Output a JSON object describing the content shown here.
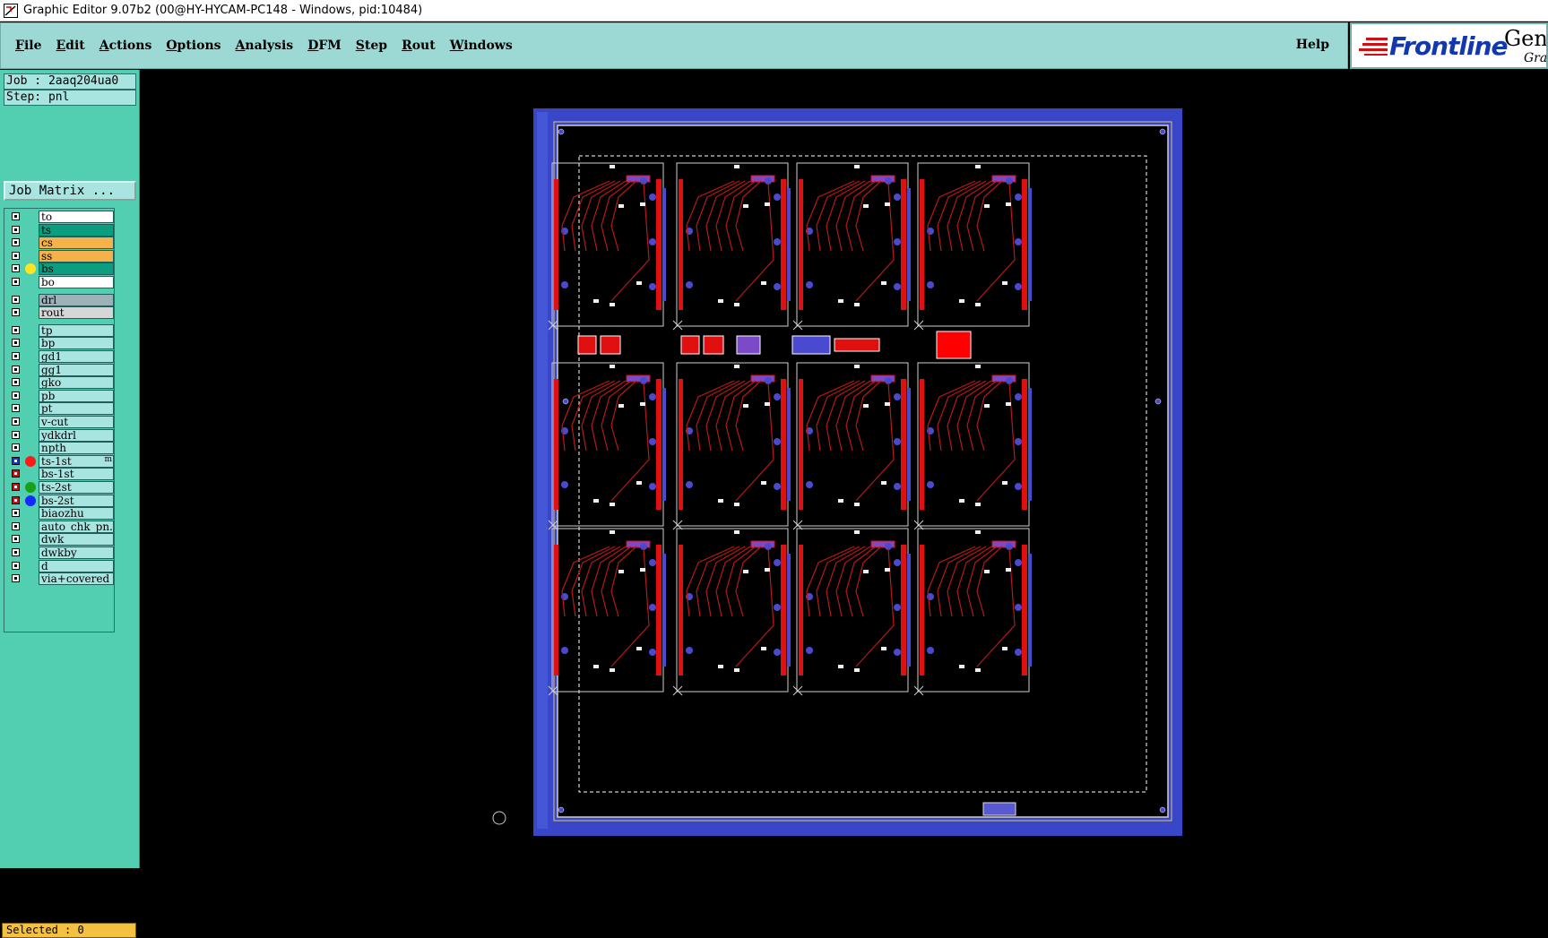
{
  "window": {
    "title": "Graphic Editor 9.07b2 (00@HY-HYCAM-PC148 - Windows, pid:10484)"
  },
  "menubar": {
    "items": [
      {
        "label": "File",
        "ul": "F",
        "rest": "ile"
      },
      {
        "label": "Edit",
        "ul": "E",
        "rest": "dit"
      },
      {
        "label": "Actions",
        "ul": "A",
        "rest": "ctions"
      },
      {
        "label": "Options",
        "ul": "O",
        "rest": "ptions"
      },
      {
        "label": "Analysis",
        "ul": "A",
        "rest": "nalysis"
      },
      {
        "label": "DFM",
        "ul": "D",
        "rest": "FM"
      },
      {
        "label": "Step",
        "ul": "S",
        "rest": "tep"
      },
      {
        "label": "Rout",
        "ul": "R",
        "rest": "out"
      },
      {
        "label": "Windows",
        "ul": "W",
        "rest": "indows"
      }
    ],
    "help": "Help"
  },
  "logo": {
    "brand": "Frontline",
    "product": "Gene",
    "sub": "Grap"
  },
  "job": {
    "job_label": "Job : 2aaq204ua0",
    "step_label": "Step: pnl",
    "matrix_button": "Job Matrix ..."
  },
  "layers": [
    {
      "name": "to",
      "color": "#ffffff"
    },
    {
      "name": "ts",
      "color": "#0a9e7e"
    },
    {
      "name": "cs",
      "color": "#f6b24a"
    },
    {
      "name": "ss",
      "color": "#f6b24a"
    },
    {
      "name": "bs",
      "color": "#0a9e7e",
      "dot": "#ffe51f"
    },
    {
      "name": "bo",
      "color": "#ffffff"
    },
    {
      "name": "drl",
      "color": "#9db2b8",
      "gap": true
    },
    {
      "name": "rout",
      "color": "#d6d6d6"
    },
    {
      "name": "tp",
      "color": "#a8e4e0",
      "gap": true
    },
    {
      "name": "bp",
      "color": "#a8e4e0"
    },
    {
      "name": "gd1",
      "color": "#a8e4e0"
    },
    {
      "name": "gg1",
      "color": "#a8e4e0"
    },
    {
      "name": "gko",
      "color": "#a8e4e0"
    },
    {
      "name": "pb",
      "color": "#a8e4e0"
    },
    {
      "name": "pt",
      "color": "#a8e4e0"
    },
    {
      "name": "v-cut",
      "color": "#a8e4e0"
    },
    {
      "name": "ydkdrl",
      "color": "#a8e4e0"
    },
    {
      "name": "npth",
      "color": "#a8e4e0"
    },
    {
      "name": "ts-1st",
      "color": "#a8e4e0",
      "dot": "#ff1a1a",
      "box": "#1038c8",
      "mark": "m"
    },
    {
      "name": "bs-1st",
      "color": "#a8e4e0",
      "box": "#d01010"
    },
    {
      "name": "ts-2st",
      "color": "#a8e4e0",
      "dot": "#18a018",
      "box": "#d01010"
    },
    {
      "name": "bs-2st",
      "color": "#a8e4e0",
      "dot": "#1428ff",
      "box": "#d01010"
    },
    {
      "name": "biaozhu",
      "color": "#a8e4e0"
    },
    {
      "name": "auto_chk_pn.",
      "color": "#a8e4e0"
    },
    {
      "name": "dwk",
      "color": "#a8e4e0"
    },
    {
      "name": "dwkby",
      "color": "#a8e4e0"
    },
    {
      "name": "d",
      "color": "#a8e4e0"
    },
    {
      "name": "via+covered",
      "color": "#a8e4e0"
    }
  ],
  "status": {
    "selected": "Selected : 0"
  },
  "colors": {
    "panel_frame": "#3a46c8",
    "copper_red": "#e01010",
    "trace": "#b81818",
    "pad_blue": "#4a4ad0",
    "outline": "#cfcfcf"
  }
}
